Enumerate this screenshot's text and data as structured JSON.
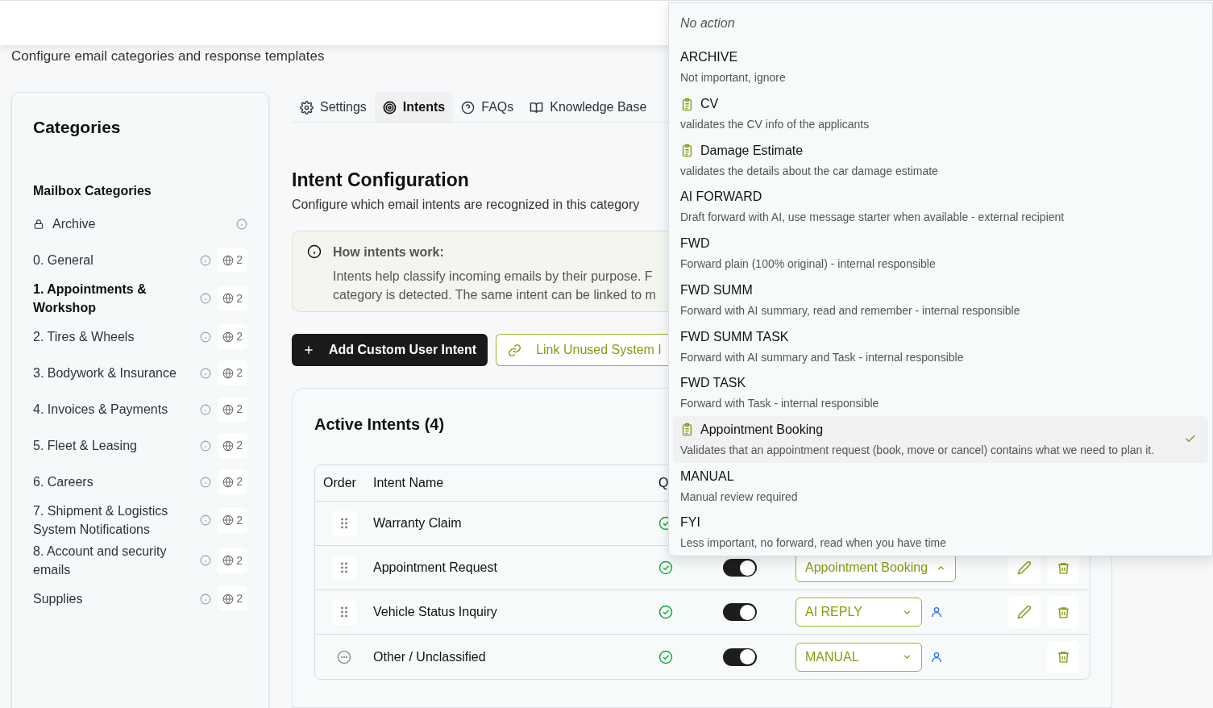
{
  "header": {
    "subtitle": "Configure email categories and response templates"
  },
  "sidebar": {
    "title": "Categories",
    "section_title": "Mailbox Categories",
    "items": [
      {
        "label": "Archive",
        "locked": true,
        "selected": false
      },
      {
        "label": "0. General",
        "locked": false,
        "badge": "2",
        "selected": false
      },
      {
        "label": "1. Appointments & Workshop",
        "locked": false,
        "badge": "2",
        "selected": true
      },
      {
        "label": "2. Tires & Wheels",
        "locked": false,
        "badge": "2",
        "selected": false
      },
      {
        "label": "3. Bodywork & Insurance",
        "locked": false,
        "badge": "2",
        "selected": false
      },
      {
        "label": "4. Invoices & Payments",
        "locked": false,
        "badge": "2",
        "selected": false
      },
      {
        "label": "5. Fleet & Leasing",
        "locked": false,
        "badge": "2",
        "selected": false
      },
      {
        "label": "6. Careers",
        "locked": false,
        "badge": "2",
        "selected": false
      },
      {
        "label": "7. Shipment & Logistics System Notifications",
        "locked": false,
        "badge": "2",
        "selected": false
      },
      {
        "label": "8. Account and security emails",
        "locked": false,
        "badge": "2",
        "selected": false
      },
      {
        "label": "Supplies",
        "locked": false,
        "badge": "2",
        "selected": false
      }
    ]
  },
  "tabs": [
    {
      "label": "Settings",
      "selected": false
    },
    {
      "label": "Intents",
      "selected": true
    },
    {
      "label": "FAQs",
      "selected": false
    },
    {
      "label": "Knowledge Base",
      "selected": false
    }
  ],
  "intent_config": {
    "title": "Intent Configuration",
    "description": "Configure which email intents are recognized in this category",
    "info": {
      "title": "How intents work:",
      "lines": [
        "Intents help classify incoming emails by their purpose. F",
        "category is detected. The same intent can be linked to m"
      ]
    },
    "buttons": [
      {
        "kind": "primary",
        "label": "Add Custom User Intent"
      },
      {
        "kind": "link",
        "label": "Link Unused System I"
      }
    ]
  },
  "active_intents": {
    "title": "Active Intents (4)",
    "columns": [
      "Order",
      "Intent Name",
      "Q"
    ],
    "rows": [
      {
        "draggable": true,
        "name": "Warranty Claim",
        "validated": true
      },
      {
        "draggable": true,
        "name": "Appointment Request",
        "validated": true,
        "on": true,
        "action": {
          "label": "Appointment Booking",
          "open": true
        },
        "assignee": false,
        "editable": true
      },
      {
        "draggable": true,
        "name": "Vehicle Status Inquiry",
        "validated": true,
        "on": true,
        "action": {
          "label": "AI REPLY",
          "open": false
        },
        "assignee": true,
        "editable": true
      },
      {
        "draggable": false,
        "name": "Other / Unclassified",
        "validated": true,
        "on": true,
        "action": {
          "label": "MANUAL",
          "open": false
        },
        "assignee": true,
        "editable": false
      }
    ]
  },
  "action_menu": {
    "items": [
      {
        "kind": "none",
        "title": "No action",
        "selected": false
      },
      {
        "kind": "plain",
        "title": "ARCHIVE",
        "description": "Not important, ignore",
        "selected": false
      },
      {
        "kind": "validator",
        "title": "CV",
        "description": "validates the CV info of the applicants",
        "selected": false
      },
      {
        "kind": "validator",
        "title": "Damage Estimate",
        "description": "validates the details about the car damage estimate",
        "selected": false
      },
      {
        "kind": "plain",
        "title": "AI FORWARD",
        "description": "Draft forward with AI, use message starter when available - external recipient",
        "selected": false
      },
      {
        "kind": "plain",
        "title": "FWD",
        "description": "Forward plain (100% original) - internal responsible",
        "selected": false
      },
      {
        "kind": "plain",
        "title": "FWD SUMM",
        "description": "Forward with AI summary, read and remember - internal responsible",
        "selected": false
      },
      {
        "kind": "plain",
        "title": "FWD SUMM TASK",
        "description": "Forward with AI summary and Task - internal responsible",
        "selected": false
      },
      {
        "kind": "plain",
        "title": "FWD TASK",
        "description": "Forward with Task - internal responsible",
        "selected": false
      },
      {
        "kind": "validator",
        "title": "Appointment Booking",
        "description": "Validates that an appointment request (book, move or cancel) contains what we need to plan it.",
        "selected": true
      },
      {
        "kind": "plain",
        "title": "MANUAL",
        "description": "Manual review required",
        "selected": false
      },
      {
        "kind": "plain",
        "title": "FYI",
        "description": "Less important, no forward, read when you have time",
        "selected": false
      }
    ]
  }
}
